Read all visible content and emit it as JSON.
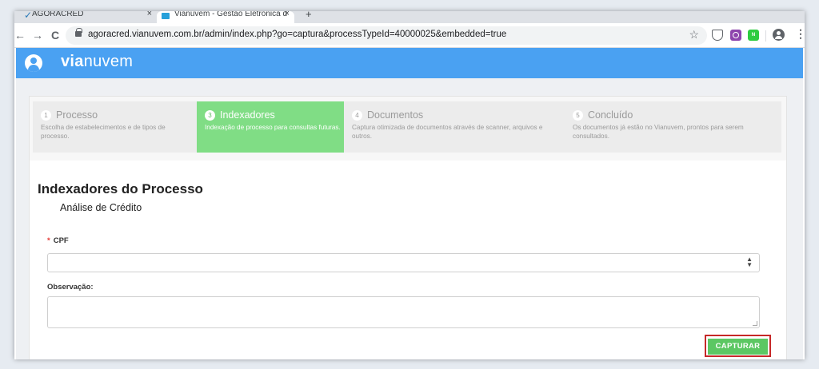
{
  "browser": {
    "tabs": [
      {
        "title": "AGORACRED",
        "close": "×"
      },
      {
        "title": "Vianuvem - Gestão Eletrônica d",
        "close": "×"
      }
    ],
    "new_tab": "+",
    "url": "agoracred.vianuvem.com.br/admin/index.php?go=captura&processTypeId=40000025&embedded=true",
    "nav": {
      "back": "←",
      "forward": "→",
      "reload": "C"
    },
    "star": "☆",
    "ext_green_label": "N",
    "menu": "⋮"
  },
  "app": {
    "logo_bold": "via",
    "logo_rest": "nuvem",
    "accent": "#4aa1f2"
  },
  "steps": [
    {
      "num": "1",
      "title": "Processo",
      "desc": "Escolha de estabelecimentos e de tipos de processo."
    },
    {
      "num": "3",
      "title": "Indexadores",
      "desc": "Indexação de processo para consultas futuras."
    },
    {
      "num": "4",
      "title": "Documentos",
      "desc": "Captura otimizada de documentos através de scanner, arquivos e outros."
    },
    {
      "num": "5",
      "title": "Concluído",
      "desc": "Os documentos já estão no Vianuvem, prontos para serem consultados."
    }
  ],
  "form": {
    "title": "Indexadores do Processo",
    "subtitle": "Análise de Crédito",
    "cpf_required": "*",
    "cpf_label": "CPF",
    "cpf_arrows": "▲\n▼",
    "obs_label": "Observação:",
    "capture_button": "CAPTURAR"
  }
}
